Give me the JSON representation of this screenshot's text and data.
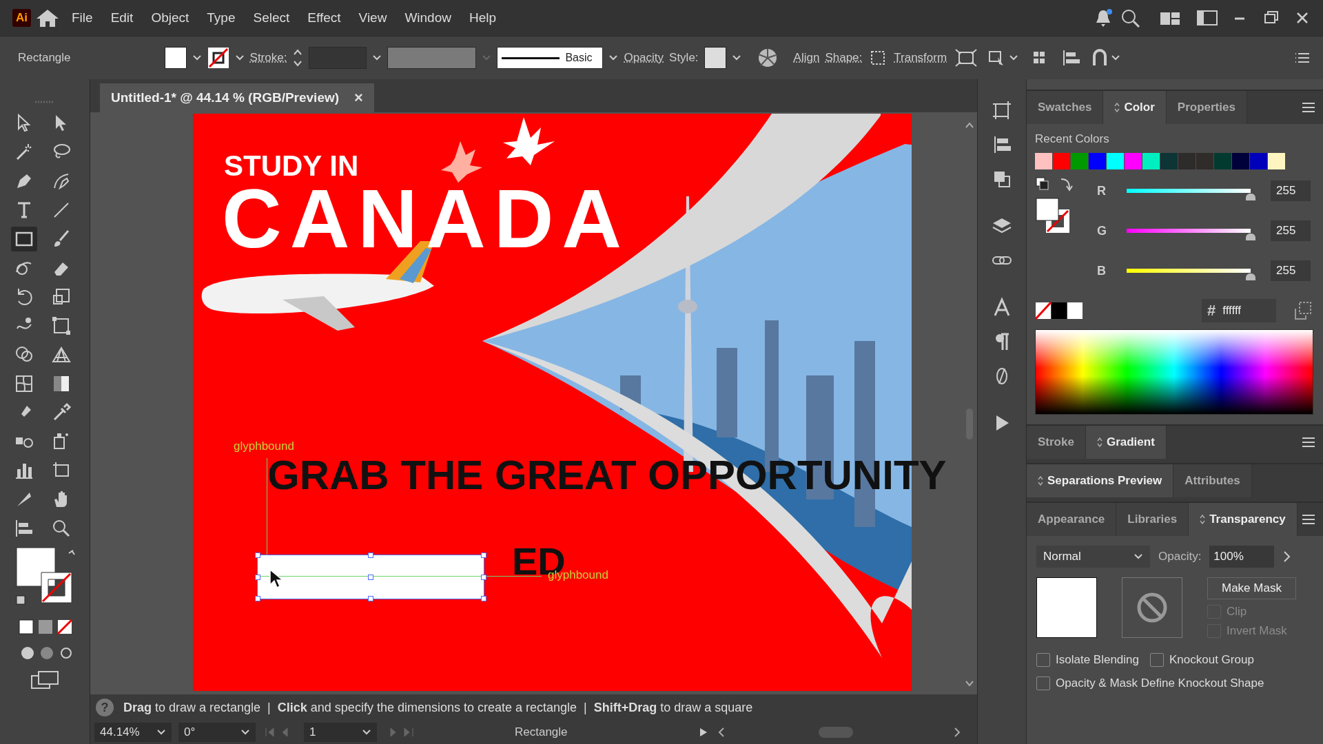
{
  "app_logo": "Ai",
  "menu": [
    "File",
    "Edit",
    "Object",
    "Type",
    "Select",
    "Effect",
    "View",
    "Window",
    "Help"
  ],
  "control_bar": {
    "tool_name": "Rectangle",
    "stroke_label": "Stroke:",
    "brush": "Basic",
    "opacity_label": "Opacity",
    "style_label": "Style:",
    "align": "Align",
    "shape": "Shape:",
    "transform": "Transform"
  },
  "document_tab": {
    "title": "Untitled-1* @ 44.14 % (RGB/Preview)",
    "close": "×"
  },
  "artboard": {
    "heading_small": "STUDY IN",
    "heading_large": "CANADA",
    "tagline": "GRAB THE GREAT OPPORTUNITY",
    "button_text": "ED",
    "guide_labels": [
      "glyphbound",
      "glyphbound"
    ]
  },
  "status_hint": "**Drag** to draw a rectangle  |  **Click** and specify the dimensions to create a rectangle  |  **Shift+Drag** to draw a square",
  "help_glyph": "?",
  "bottom_bar": {
    "zoom": "44.14%",
    "rotation": "0°",
    "artboard": "1",
    "tool": "Rectangle"
  },
  "color_panel": {
    "tabs": [
      {
        "label": "Swatches",
        "selected": false
      },
      {
        "label": "Color",
        "selected": true
      },
      {
        "label": "Properties",
        "selected": false
      }
    ],
    "recent_label": "Recent Colors",
    "recent_colors": [
      {
        "color": "#ffc0c0"
      },
      {
        "color": "#ff0000"
      },
      {
        "color": "#009900"
      },
      {
        "color": "#0000ff"
      },
      {
        "color": "#00ffff"
      },
      {
        "color": "#ff00ff"
      },
      {
        "color": "#00eec0"
      },
      {
        "color": "#0d3535"
      },
      {
        "color": "#2e2b2b"
      },
      {
        "color": "#302c2a"
      },
      {
        "color": "#023a30"
      },
      {
        "color": "#00003a"
      },
      {
        "color": "#0000bb"
      },
      {
        "color": "#fff5c0"
      }
    ],
    "sliders": [
      {
        "label": "R",
        "color": "#00ffff",
        "level": 1,
        "value": "255"
      },
      {
        "label": "G",
        "color": "#ff00ff",
        "level": 1,
        "value": "255"
      },
      {
        "label": "B",
        "color": "#ffff00",
        "level": 1,
        "value": "255"
      }
    ],
    "hex_prefix": "#",
    "hex": "ffffff"
  },
  "gradient_tabs": [
    {
      "label": "Stroke",
      "selected": false
    },
    {
      "label": "Gradient",
      "selected": true
    }
  ],
  "separation_tabs": [
    {
      "label": "Separations Preview",
      "selected": true
    },
    {
      "label": "Attributes",
      "selected": false
    }
  ],
  "transparency_panel": {
    "tabs": [
      {
        "label": "Appearance",
        "selected": false
      },
      {
        "label": "Libraries",
        "selected": false
      },
      {
        "label": "Transparency",
        "selected": true
      }
    ],
    "blend_mode": "Normal",
    "opacity_label": "Opacity:",
    "opacity": "100%",
    "make_mask": "Make Mask",
    "mask_options": [
      {
        "label": "Clip",
        "checked": false,
        "disabled": true
      },
      {
        "label": "Invert Mask",
        "checked": false,
        "disabled": true
      }
    ],
    "options": [
      {
        "label": "Isolate Blending",
        "checked": false,
        "disabled": false
      },
      {
        "label": "Knockout Group",
        "checked": false,
        "disabled": false
      },
      {
        "label": "Opacity & Mask Define Knockout Shape",
        "checked": false,
        "disabled": false
      }
    ]
  }
}
